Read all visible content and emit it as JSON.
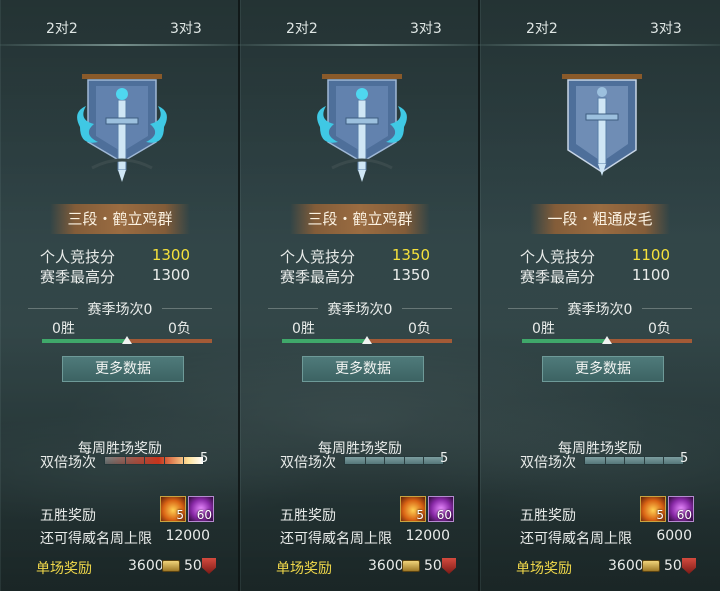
{
  "panels": [
    {
      "tabs": [
        "2对2",
        "3对3"
      ],
      "emblem": "flaming-sword-banner-icon",
      "rank": "三段・鹤立鸡群",
      "personal_score_label": "个人竞技分",
      "personal_score": "1300",
      "season_high_label": "赛季最高分",
      "season_high": "1300",
      "season_matches": "赛季场次0",
      "wins": "0胜",
      "losses": "0负",
      "more_data": "更多数据",
      "weekly_title": "每周胜场奖励",
      "double_label": "双倍场次",
      "double_count": "5",
      "double_progress": 1.0,
      "five_win_label": "五胜奖励",
      "five_win_items": [
        {
          "icon": "fire-token-icon",
          "count": "5"
        },
        {
          "icon": "purple-gem-icon",
          "count": "60"
        }
      ],
      "limit_label": "还可得威名周上限",
      "limit_value": "12000",
      "single_label": "单场奖励",
      "single_coin": "3600",
      "single_rep": "50"
    },
    {
      "tabs": [
        "2对2",
        "3对3"
      ],
      "emblem": "flaming-sword-banner-icon",
      "rank": "三段・鹤立鸡群",
      "personal_score_label": "个人竞技分",
      "personal_score": "1350",
      "season_high_label": "赛季最高分",
      "season_high": "1350",
      "season_matches": "赛季场次0",
      "wins": "0胜",
      "losses": "0负",
      "more_data": "更多数据",
      "weekly_title": "每周胜场奖励",
      "double_label": "双倍场次",
      "double_count": "5",
      "double_progress": 0.0,
      "five_win_label": "五胜奖励",
      "five_win_items": [
        {
          "icon": "fire-token-icon",
          "count": "5"
        },
        {
          "icon": "purple-gem-icon",
          "count": "60"
        }
      ],
      "limit_label": "还可得威名周上限",
      "limit_value": "12000",
      "single_label": "单场奖励",
      "single_coin": "3600",
      "single_rep": "50"
    },
    {
      "tabs": [
        "2对2",
        "3对3"
      ],
      "emblem": "sword-banner-icon",
      "rank": "一段・粗通皮毛",
      "personal_score_label": "个人竞技分",
      "personal_score": "1100",
      "season_high_label": "赛季最高分",
      "season_high": "1100",
      "season_matches": "赛季场次0",
      "wins": "0胜",
      "losses": "0负",
      "more_data": "更多数据",
      "weekly_title": "每周胜场奖励",
      "double_label": "双倍场次",
      "double_count": "5",
      "double_progress": 0.0,
      "five_win_label": "五胜奖励",
      "five_win_items": [
        {
          "icon": "fire-token-icon",
          "count": "5"
        },
        {
          "icon": "purple-gem-icon",
          "count": "60"
        }
      ],
      "limit_label": "还可得威名周上限",
      "limit_value": "6000",
      "single_label": "单场奖励",
      "single_coin": "3600",
      "single_rep": "50"
    }
  ],
  "colors": {
    "highlight_score": "#f4e13c",
    "single_label": "#f0d84a",
    "win_bar": "#3fa86a",
    "loss_bar": "#a35a36"
  },
  "win_ratio": 0.5
}
